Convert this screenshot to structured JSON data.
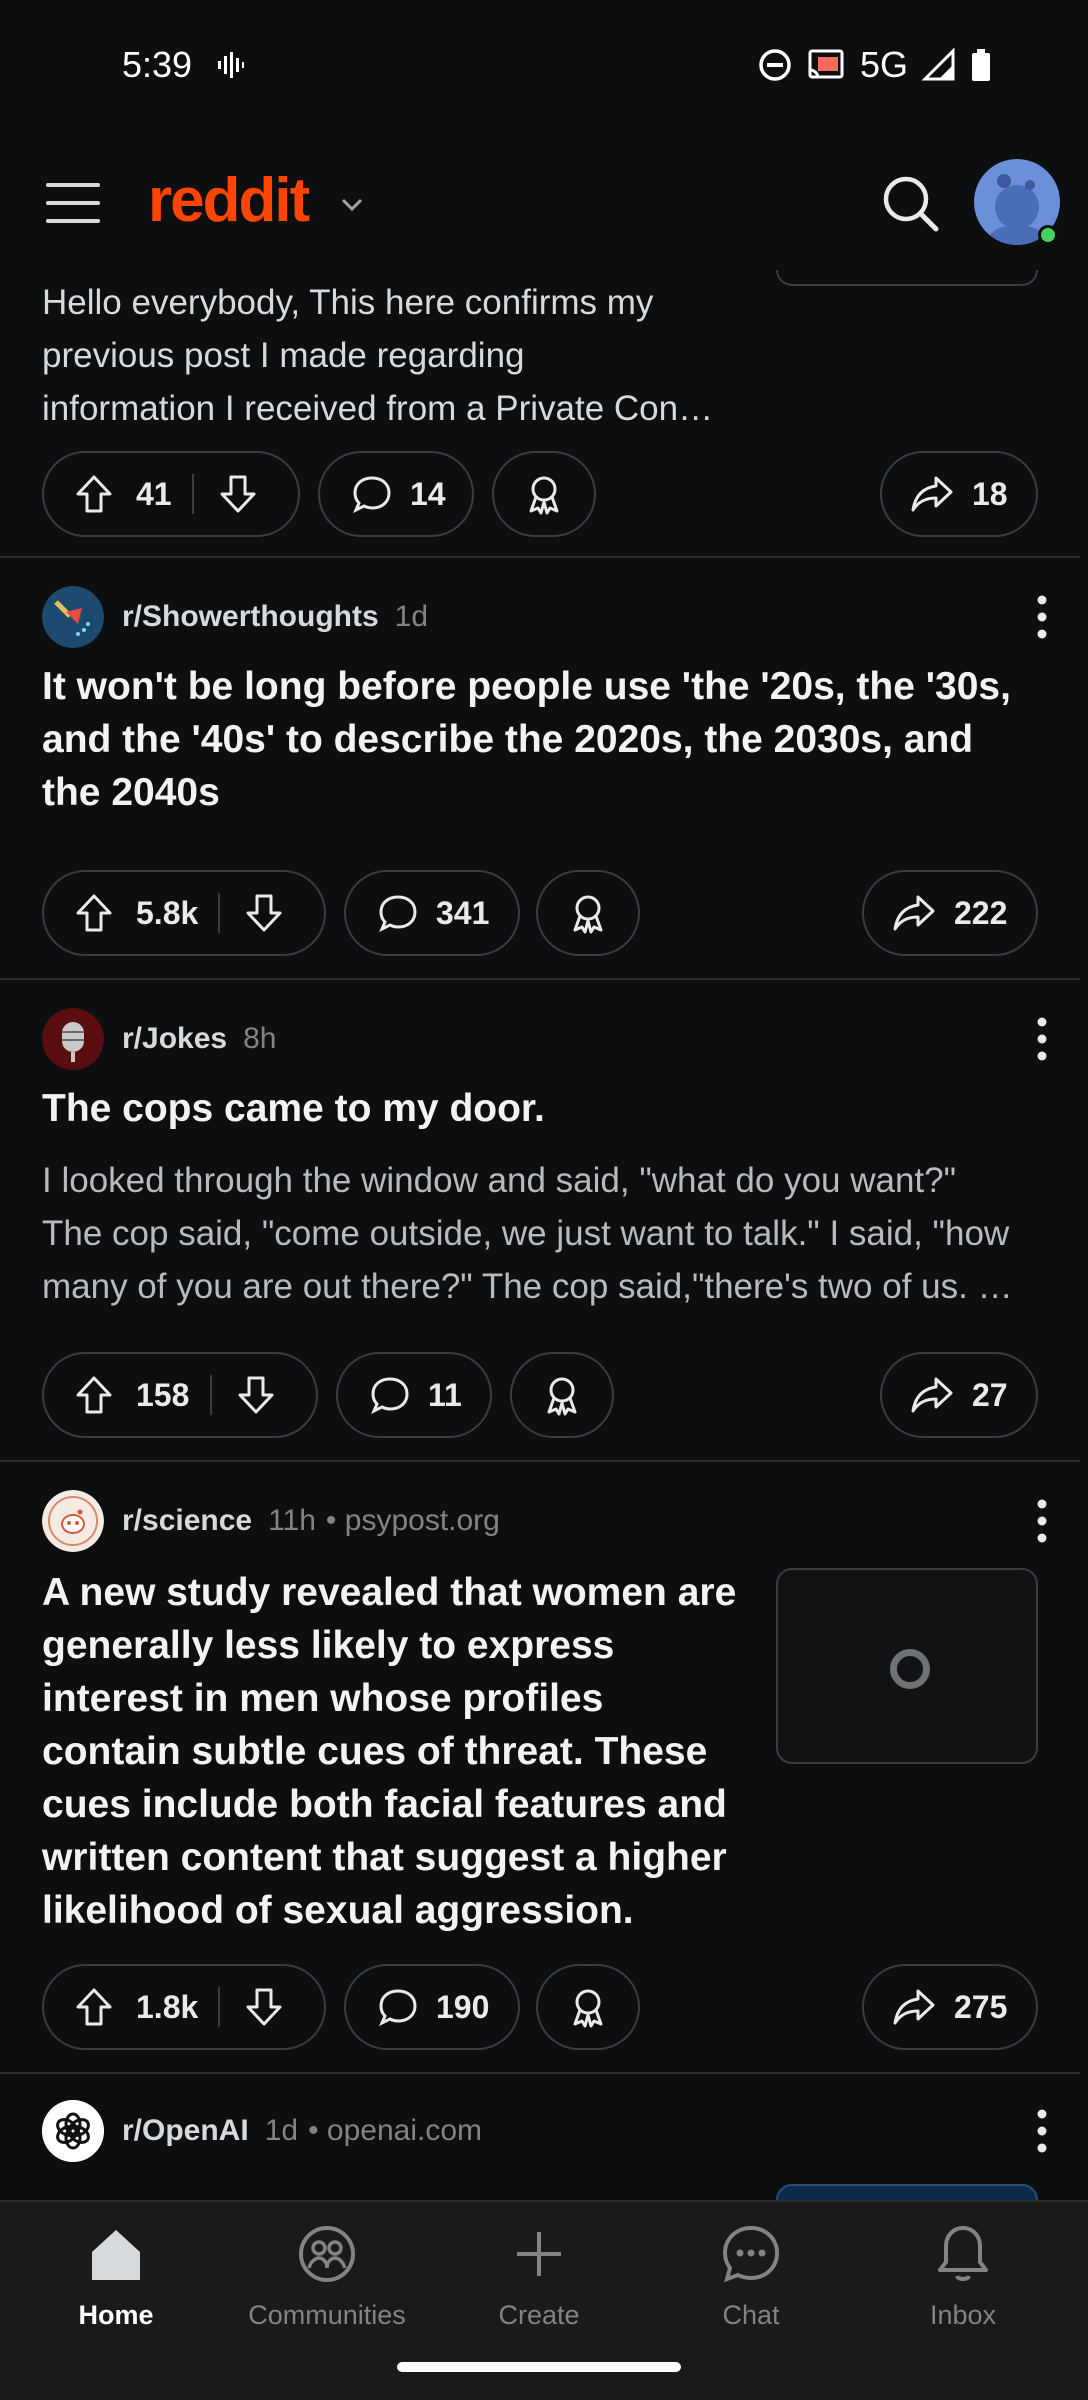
{
  "status": {
    "time": "5:39",
    "network": "5G"
  },
  "header": {
    "logo": "reddit"
  },
  "posts": [
    {
      "body": "Hello everybody, This here confirms my previous post I made regarding information I received from a Private Con…",
      "body_lines": [
        "Hello everybody, This here confirms my",
        "previous post I made regarding",
        "information I received from a Private Con…"
      ],
      "upvotes": "41",
      "comments": "14",
      "shares": "18"
    },
    {
      "subreddit": "r/Showerthoughts",
      "age": "1d",
      "title_lines": [
        "It won't be long before people use 'the '20s, the '30s,",
        "and the '40s' to describe the 2020s, the 2030s, and",
        "the 2040s"
      ],
      "upvotes": "5.8k",
      "comments": "341",
      "shares": "222"
    },
    {
      "subreddit": "r/Jokes",
      "age": "8h",
      "title_lines": [
        "The cops came to my door."
      ],
      "body_lines": [
        "I looked through the window and said, \"what do you want?\"",
        "The cop said, \"come outside, we just want to talk.\" I said, \"how",
        "many of you are out there?\" The cop said,\"there's two of us. …"
      ],
      "upvotes": "158",
      "comments": "11",
      "shares": "27"
    },
    {
      "subreddit": "r/science",
      "age": "11h",
      "domain": "• psypost.org",
      "title_lines": [
        "A new study revealed that women are",
        "generally less likely to express",
        "interest in men whose profiles",
        "contain subtle cues of threat. These",
        "cues include both facial features and",
        "written content that suggest a higher",
        "likelihood of sexual aggression."
      ],
      "upvotes": "1.8k",
      "comments": "190",
      "shares": "275"
    },
    {
      "subreddit": "r/OpenAI",
      "age": "1d",
      "domain": "• openai.com"
    }
  ],
  "nav": {
    "items": [
      {
        "label": "Home",
        "icon": "home-icon"
      },
      {
        "label": "Communities",
        "icon": "communities-icon"
      },
      {
        "label": "Create",
        "icon": "create-icon"
      },
      {
        "label": "Chat",
        "icon": "chat-icon"
      },
      {
        "label": "Inbox",
        "icon": "bell-icon"
      }
    ]
  },
  "colors": {
    "brand": "#ff4500",
    "background": "#0c0e10",
    "online": "#46d160"
  }
}
